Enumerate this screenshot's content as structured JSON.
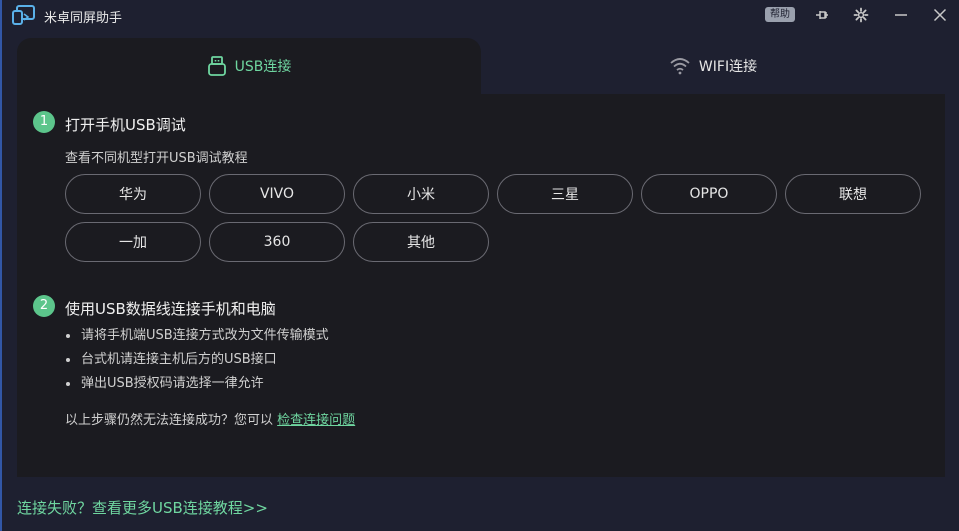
{
  "app": {
    "title": "米卓同屏助手",
    "help_label": "帮助"
  },
  "tabs": [
    {
      "label": "USB连接",
      "icon": "usb-icon",
      "active": true
    },
    {
      "label": "WIFI连接",
      "icon": "wifi-icon",
      "active": false
    }
  ],
  "step1": {
    "number": "1",
    "title": "打开手机USB调试",
    "subtitle": "查看不同机型打开USB调试教程",
    "brands": [
      "华为",
      "VIVO",
      "小米",
      "三星",
      "OPPO",
      "联想",
      "一加",
      "360",
      "其他"
    ]
  },
  "step2": {
    "number": "2",
    "title": "使用USB数据线连接手机和电脑",
    "bullets": [
      "请将手机端USB连接方式改为文件传输模式",
      "台式机请连接主机后方的USB接口",
      "弹出USB授权码请选择一律允许"
    ],
    "trouble_text": "以上步骤仍然无法连接成功？您可以",
    "trouble_link": "检查连接问题"
  },
  "footer": {
    "link": "连接失败？查看更多USB连接教程>>"
  },
  "colors": {
    "accent": "#6fd6a0",
    "step_badge": "#5cc58b",
    "background": "#1e2030",
    "panel": "#1b1b20"
  }
}
